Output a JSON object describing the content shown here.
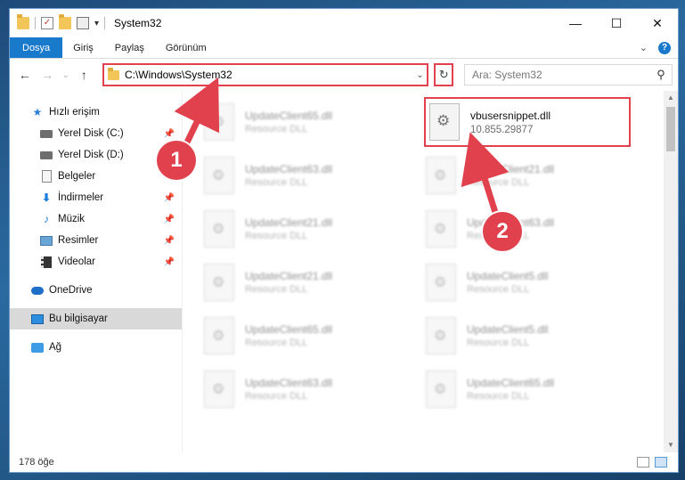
{
  "window": {
    "title": "System32",
    "controls": {
      "minimize": "—",
      "maximize": "☐",
      "close": "✕"
    }
  },
  "ribbon": {
    "tabs": [
      "Dosya",
      "Giriş",
      "Paylaş",
      "Görünüm"
    ],
    "help": "?"
  },
  "navbar": {
    "back": "←",
    "forward": "→",
    "recent": "⌄",
    "up": "↑",
    "address": "C:\\Windows\\System32",
    "address_dropdown": "⌄",
    "refresh": "↻",
    "search_placeholder": "Ara: System32",
    "search_icon": "⚲"
  },
  "sidebar": {
    "items": [
      {
        "label": "Hızlı erişim",
        "icon": "star-icon"
      },
      {
        "label": "Yerel Disk (C:)",
        "icon": "drive-icon",
        "pinned": true
      },
      {
        "label": "Yerel Disk (D:)",
        "icon": "drive-icon"
      },
      {
        "label": "Belgeler",
        "icon": "documents-icon"
      },
      {
        "label": "İndirmeler",
        "icon": "downloads-icon",
        "pinned": true
      },
      {
        "label": "Müzik",
        "icon": "music-icon",
        "pinned": true
      },
      {
        "label": "Resimler",
        "icon": "pictures-icon",
        "pinned": true
      },
      {
        "label": "Videolar",
        "icon": "videos-icon",
        "pinned": true
      },
      {
        "label": "OneDrive",
        "icon": "onedrive-icon"
      },
      {
        "label": "Bu bilgisayar",
        "icon": "this-pc-icon",
        "selected": true
      },
      {
        "label": "Ağ",
        "icon": "network-icon"
      }
    ],
    "pin_glyph": "📌"
  },
  "files": {
    "highlighted": {
      "name": "vbusersnippet.dll",
      "version": "10.855.29877"
    },
    "background_left": [
      {
        "name": "UpdateClient65.dll",
        "desc": "Resource DLL"
      },
      {
        "name": "UpdateClient63.dll",
        "desc": "Resource DLL"
      },
      {
        "name": "UpdateClient21.dll",
        "desc": "Resource DLL"
      },
      {
        "name": "UpdateClient21.dll",
        "desc": "Resource DLL"
      },
      {
        "name": "UpdateClient65.dll",
        "desc": "Resource DLL"
      },
      {
        "name": "UpdateClient63.dll",
        "desc": "Resource DLL"
      }
    ],
    "background_right": [
      {
        "name": "UpdateClient21.dll",
        "desc": "Resource DLL"
      },
      {
        "name": "UpdateClient63.dll",
        "desc": "Resource DLL"
      },
      {
        "name": "UpdateClient5.dll",
        "desc": "Resource DLL"
      },
      {
        "name": "UpdateClient5.dll",
        "desc": "Resource DLL"
      },
      {
        "name": "UpdateClient65.dll",
        "desc": "Resource DLL"
      }
    ]
  },
  "status": {
    "count": "178 öğe"
  },
  "callouts": {
    "one": "1",
    "two": "2"
  },
  "colors": {
    "accent": "#1979ca",
    "highlight": "#e0414d",
    "selected_bg": "#d9d9d9"
  }
}
